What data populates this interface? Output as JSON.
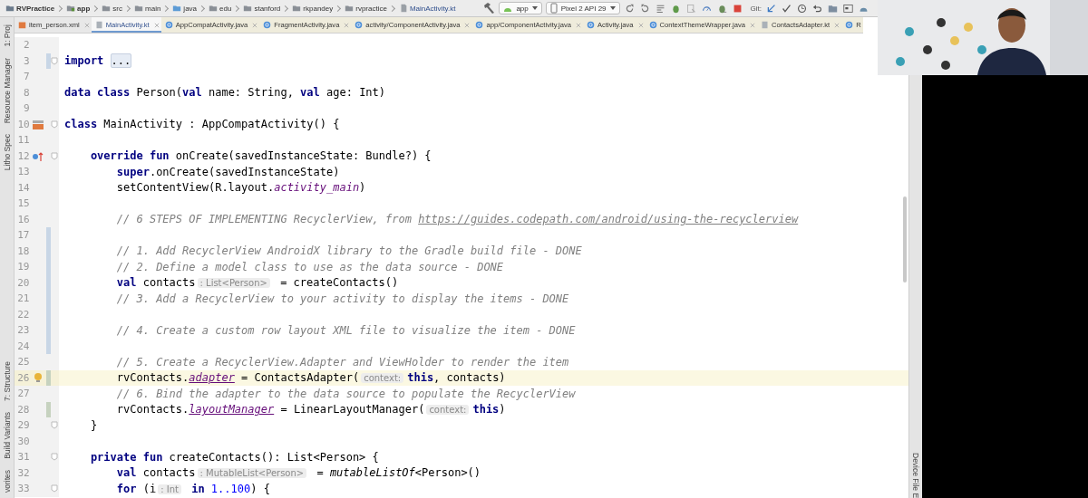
{
  "breadcrumb": [
    {
      "label": "RVPractice",
      "kind": "project"
    },
    {
      "label": "app",
      "kind": "module"
    },
    {
      "label": "src",
      "kind": "folder"
    },
    {
      "label": "main",
      "kind": "folder"
    },
    {
      "label": "java",
      "kind": "source"
    },
    {
      "label": "edu",
      "kind": "folder"
    },
    {
      "label": "stanford",
      "kind": "folder"
    },
    {
      "label": "rkpandey",
      "kind": "folder"
    },
    {
      "label": "rvpractice",
      "kind": "folder"
    },
    {
      "label": "MainActivity.kt",
      "kind": "file"
    }
  ],
  "toolbar": {
    "run_config": "app",
    "device": "Pixel 2 API 29",
    "git_label": "Git:"
  },
  "tabs": [
    {
      "label": "item_person.xml",
      "kind": "xml",
      "selected": false,
      "closable": true
    },
    {
      "label": "MainActivity.kt",
      "kind": "kotlin",
      "selected": true,
      "closable": true
    },
    {
      "label": "AppCompatActivity.java",
      "kind": "java",
      "selected": false,
      "closable": true
    },
    {
      "label": "FragmentActivity.java",
      "kind": "java",
      "selected": false,
      "closable": true
    },
    {
      "label": "activity/ComponentActivity.java",
      "kind": "java",
      "selected": false,
      "closable": true
    },
    {
      "label": "app/ComponentActivity.java",
      "kind": "java",
      "selected": false,
      "closable": true
    },
    {
      "label": "Activity.java",
      "kind": "java",
      "selected": false,
      "closable": true
    },
    {
      "label": "ContextThemeWrapper.java",
      "kind": "java",
      "selected": false,
      "closable": true
    },
    {
      "label": "ContactsAdapter.kt",
      "kind": "kotlin",
      "selected": false,
      "closable": true
    },
    {
      "label": "R",
      "kind": "java",
      "selected": false,
      "closable": false
    }
  ],
  "left_tool_strip": {
    "top": [
      "1: Proj",
      "Resource Manager",
      "Litho Spec"
    ],
    "bottom": [
      "7: Structure",
      "Build Variants",
      "vorites"
    ]
  },
  "right_tool_strip": [
    "Device File E"
  ],
  "lines": [
    {
      "number": "2"
    },
    {
      "number": "3",
      "fold": true,
      "change": {
        "kind": "modified"
      },
      "segments": [
        {
          "kind": "keyword",
          "text": "import "
        },
        {
          "kind": "folded",
          "text": "..."
        }
      ]
    },
    {
      "number": "7"
    },
    {
      "number": "8",
      "segments": [
        {
          "kind": "keyword",
          "text": "data class"
        },
        {
          "kind": "plain",
          "text": " Person("
        },
        {
          "kind": "keyword",
          "text": "val"
        },
        {
          "kind": "plain",
          "text": " name: String, "
        },
        {
          "kind": "keyword",
          "text": "val"
        },
        {
          "kind": "plain",
          "text": " age: Int)"
        }
      ]
    },
    {
      "number": "9"
    },
    {
      "number": "10",
      "fold": true,
      "marker": {
        "kind": "android"
      },
      "segments": [
        {
          "kind": "keyword",
          "text": "class"
        },
        {
          "kind": "plain",
          "text": " MainActivity : AppCompatActivity() {"
        }
      ]
    },
    {
      "number": "11"
    },
    {
      "number": "12",
      "fold": true,
      "marker": {
        "kind": "override"
      },
      "segments": [
        {
          "kind": "keyword",
          "text": "    override fun"
        },
        {
          "kind": "plain",
          "text": " onCreate(savedInstanceState: Bundle?) {"
        }
      ]
    },
    {
      "number": "13",
      "segments": [
        {
          "kind": "keyword",
          "text": "        super"
        },
        {
          "kind": "plain",
          "text": ".onCreate(savedInstanceState)"
        }
      ]
    },
    {
      "number": "14",
      "segments": [
        {
          "kind": "plain",
          "text": "        setContentView(R.layout."
        },
        {
          "kind": "static",
          "text": "activity_main"
        },
        {
          "kind": "plain",
          "text": ")"
        }
      ]
    },
    {
      "number": "15"
    },
    {
      "number": "16",
      "segments": [
        {
          "kind": "comment",
          "text": "        // 6 STEPS OF IMPLEMENTING RecyclerView, from "
        },
        {
          "kind": "link",
          "text": "https://guides.codepath.com/android/using-the-recyclerview"
        }
      ]
    },
    {
      "number": "17",
      "change": {
        "kind": "modified"
      }
    },
    {
      "number": "18",
      "change": {
        "kind": "modified"
      },
      "segments": [
        {
          "kind": "comment",
          "text": "        // 1. Add RecyclerView AndroidX library to the Gradle build file - DONE"
        }
      ]
    },
    {
      "number": "19",
      "change": {
        "kind": "modified"
      },
      "segments": [
        {
          "kind": "comment",
          "text": "        // 2. Define a model class to use as the data source - DONE"
        }
      ]
    },
    {
      "number": "20",
      "change": {
        "kind": "modified"
      },
      "segments": [
        {
          "kind": "keyword",
          "text": "        val"
        },
        {
          "kind": "plain",
          "text": " contacts"
        },
        {
          "kind": "hint",
          "text": ": List<Person>"
        },
        {
          "kind": "plain",
          "text": " = createContacts()"
        }
      ]
    },
    {
      "number": "21",
      "change": {
        "kind": "modified"
      },
      "segments": [
        {
          "kind": "comment",
          "text": "        // 3. Add a RecyclerView to your activity to display the items - DONE"
        }
      ]
    },
    {
      "number": "22",
      "change": {
        "kind": "modified"
      }
    },
    {
      "number": "23",
      "change": {
        "kind": "modified"
      },
      "segments": [
        {
          "kind": "comment",
          "text": "        // 4. Create a custom row layout XML file to visualize the item - DONE"
        }
      ]
    },
    {
      "number": "24",
      "change": {
        "kind": "modified"
      }
    },
    {
      "number": "25",
      "segments": [
        {
          "kind": "comment",
          "text": "        // 5. Create a RecyclerView.Adapter and ViewHolder to render the item"
        }
      ]
    },
    {
      "number": "26",
      "current": true,
      "change": {
        "kind": "added"
      },
      "marker": {
        "kind": "bulb"
      },
      "segments": [
        {
          "kind": "plain",
          "text": "        rvContacts."
        },
        {
          "kind": "synthetic",
          "text": "adapter"
        },
        {
          "kind": "plain",
          "text": " = ContactsAdapter("
        },
        {
          "kind": "hint",
          "text": "context:"
        },
        {
          "kind": "keyword",
          "text": "this"
        },
        {
          "kind": "plain",
          "text": ", contacts)"
        }
      ]
    },
    {
      "number": "27",
      "segments": [
        {
          "kind": "comment",
          "text": "        // 6. Bind the adapter to the data source to populate the RecyclerView"
        }
      ]
    },
    {
      "number": "28",
      "change": {
        "kind": "added"
      },
      "segments": [
        {
          "kind": "plain",
          "text": "        rvContacts."
        },
        {
          "kind": "synthetic",
          "text": "layoutManager"
        },
        {
          "kind": "plain",
          "text": " = LinearLayoutManager("
        },
        {
          "kind": "hint",
          "text": "context:"
        },
        {
          "kind": "keyword",
          "text": "this"
        },
        {
          "kind": "plain",
          "text": ")"
        }
      ]
    },
    {
      "number": "29",
      "fold": true,
      "segments": [
        {
          "kind": "plain",
          "text": "    }"
        }
      ]
    },
    {
      "number": "30"
    },
    {
      "number": "31",
      "fold": true,
      "segments": [
        {
          "kind": "keyword",
          "text": "    private fun"
        },
        {
          "kind": "plain",
          "text": " createContacts(): List<Person> {"
        }
      ]
    },
    {
      "number": "32",
      "segments": [
        {
          "kind": "keyword",
          "text": "        val"
        },
        {
          "kind": "plain",
          "text": " contacts"
        },
        {
          "kind": "hint",
          "text": ": MutableList<Person>"
        },
        {
          "kind": "plain",
          "text": " = "
        },
        {
          "kind": "call",
          "text": "mutableListOf"
        },
        {
          "kind": "plain",
          "text": "<Person>()"
        }
      ]
    },
    {
      "number": "33",
      "fold": true,
      "segments": [
        {
          "kind": "keyword",
          "text": "        for"
        },
        {
          "kind": "plain",
          "text": " (i"
        },
        {
          "kind": "hint",
          "text": ": Int"
        },
        {
          "kind": "keyword",
          "text": " in "
        },
        {
          "kind": "number",
          "text": "1..100"
        },
        {
          "kind": "plain",
          "text": ") {"
        }
      ]
    }
  ],
  "webcam": {
    "kind": "picture"
  }
}
